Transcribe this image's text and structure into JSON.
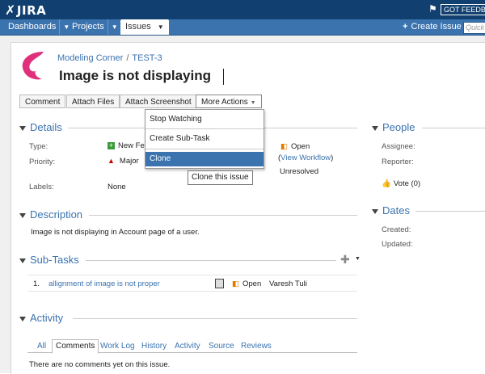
{
  "header": {
    "logo": "JIRA",
    "feedback": "GOT FEEDBACK"
  },
  "nav": {
    "dashboards": "Dashboards",
    "projects": "Projects",
    "issues": "Issues",
    "create_issue": "Create Issue",
    "quick_search_placeholder": "Quick"
  },
  "issue": {
    "project": "Modeling Corner",
    "key": "TEST-3",
    "breadcrumb_sep": "/",
    "title": "Image is not displaying"
  },
  "toolbar": {
    "comment": "Comment",
    "attach_files": "Attach Files",
    "attach_screenshot": "Attach Screenshot",
    "more_actions": "More Actions"
  },
  "menu": {
    "stop_watching": "Stop Watching",
    "create_subtask": "Create Sub-Task",
    "clone": "Clone",
    "tooltip": "Clone this issue"
  },
  "details": {
    "heading": "Details",
    "type_label": "Type:",
    "type_value": "New Fe",
    "priority_label": "Priority:",
    "priority_value": "Major",
    "labels_label": "Labels:",
    "labels_value": "None",
    "status_value": "Open",
    "view_workflow": "View Workflow",
    "resolution_value": "Unresolved"
  },
  "people": {
    "heading": "People",
    "assignee_label": "Assignee:",
    "reporter_label": "Reporter:",
    "vote": "Vote (0)"
  },
  "dates": {
    "heading": "Dates",
    "created_label": "Created:",
    "updated_label": "Updated:"
  },
  "description": {
    "heading": "Description",
    "text": "Image is not displaying in Account page of a user."
  },
  "subtasks": {
    "heading": "Sub-Tasks",
    "items": [
      {
        "num": "1.",
        "title": "allignment of image is not proper",
        "status": "Open",
        "assignee": "Varesh Tuli"
      }
    ]
  },
  "activity": {
    "heading": "Activity",
    "tabs": [
      "All",
      "Comments",
      "Work Log",
      "History",
      "Activity",
      "Source",
      "Reviews"
    ],
    "empty": "There are no comments yet on this issue."
  },
  "colors": {
    "header": "#114070",
    "nav": "#3b73af",
    "link": "#3b73af"
  }
}
